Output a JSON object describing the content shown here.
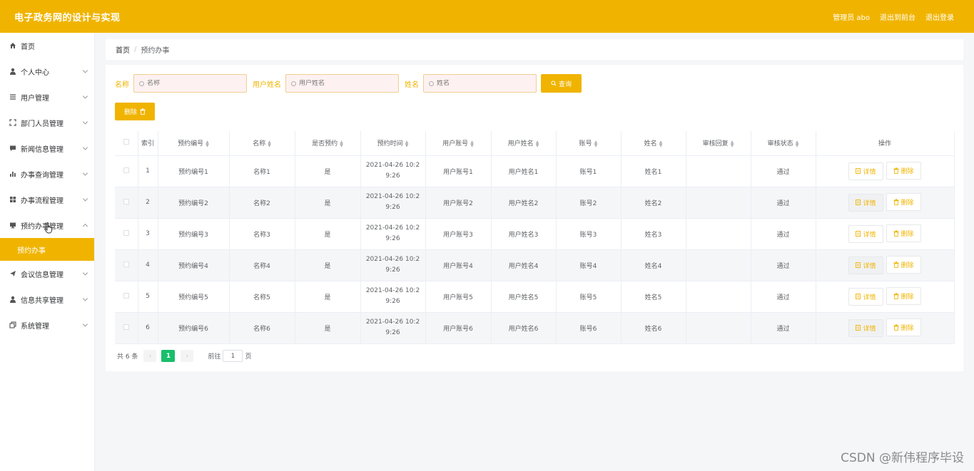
{
  "header": {
    "title": "电子政务网的设计与实现",
    "admin_label": "管理员 abo",
    "goto_front": "退出到前台",
    "logout": "退出登录"
  },
  "sidebar": {
    "items": [
      {
        "label": "首页",
        "icon": "home-icon"
      },
      {
        "label": "个人中心",
        "icon": "user-icon"
      },
      {
        "label": "用户管理",
        "icon": "list-icon"
      },
      {
        "label": "部门人员管理",
        "icon": "fullscreen-icon"
      },
      {
        "label": "新闻信息管理",
        "icon": "message-icon"
      },
      {
        "label": "办事查询管理",
        "icon": "chart-icon"
      },
      {
        "label": "办事流程管理",
        "icon": "grid-icon"
      },
      {
        "label": "预约办事管理",
        "icon": "monitor-icon"
      },
      {
        "label": "会议信息管理",
        "icon": "send-icon"
      },
      {
        "label": "信息共享管理",
        "icon": "user-icon"
      },
      {
        "label": "系统管理",
        "icon": "copy-icon"
      }
    ],
    "active_sub": "预约办事"
  },
  "breadcrumb": {
    "home": "首页",
    "sep": "/",
    "current": "预约办事"
  },
  "search": {
    "name_label": "名称",
    "name_placeholder": "名称",
    "username_label": "用户姓名",
    "username_placeholder": "用户姓名",
    "realname_label": "姓名",
    "realname_placeholder": "姓名",
    "query_label": "查询"
  },
  "toolbar": {
    "delete_label": "删除"
  },
  "table": {
    "headers": [
      "索引",
      "预约编号",
      "名称",
      "是否预约",
      "预约时间",
      "用户账号",
      "用户姓名",
      "账号",
      "姓名",
      "审核回复",
      "审核状态",
      "操作"
    ],
    "rows": [
      {
        "index": "1",
        "code": "预约编号1",
        "name": "名称1",
        "booked": "是",
        "time1": "2021-04-26 10:2",
        "time2": "9:26",
        "account": "用户账号1",
        "username": "用户姓名1",
        "acct": "账号1",
        "realname": "姓名1",
        "reply": "",
        "status": "通过"
      },
      {
        "index": "2",
        "code": "预约编号2",
        "name": "名称2",
        "booked": "是",
        "time1": "2021-04-26 10:2",
        "time2": "9:26",
        "account": "用户账号2",
        "username": "用户姓名2",
        "acct": "账号2",
        "realname": "姓名2",
        "reply": "",
        "status": "通过"
      },
      {
        "index": "3",
        "code": "预约编号3",
        "name": "名称3",
        "booked": "是",
        "time1": "2021-04-26 10:2",
        "time2": "9:26",
        "account": "用户账号3",
        "username": "用户姓名3",
        "acct": "账号3",
        "realname": "姓名3",
        "reply": "",
        "status": "通过"
      },
      {
        "index": "4",
        "code": "预约编号4",
        "name": "名称4",
        "booked": "是",
        "time1": "2021-04-26 10:2",
        "time2": "9:26",
        "account": "用户账号4",
        "username": "用户姓名4",
        "acct": "账号4",
        "realname": "姓名4",
        "reply": "",
        "status": "通过"
      },
      {
        "index": "5",
        "code": "预约编号5",
        "name": "名称5",
        "booked": "是",
        "time1": "2021-04-26 10:2",
        "time2": "9:26",
        "account": "用户账号5",
        "username": "用户姓名5",
        "acct": "账号5",
        "realname": "姓名5",
        "reply": "",
        "status": "通过"
      },
      {
        "index": "6",
        "code": "预约编号6",
        "name": "名称6",
        "booked": "是",
        "time1": "2021-04-26 10:2",
        "time2": "9:26",
        "account": "用户账号6",
        "username": "用户姓名6",
        "acct": "账号6",
        "realname": "姓名6",
        "reply": "",
        "status": "通过"
      }
    ],
    "detail_label": "详情",
    "delete_label": "删除"
  },
  "pagination": {
    "total_text": "共 6 条",
    "current_page": "1",
    "goto_label": "前往",
    "goto_value": "1",
    "page_suffix": "页"
  },
  "watermark": "CSDN @新伟程序毕设",
  "colors": {
    "accent": "#f0b400",
    "page_active": "#19be6b"
  }
}
